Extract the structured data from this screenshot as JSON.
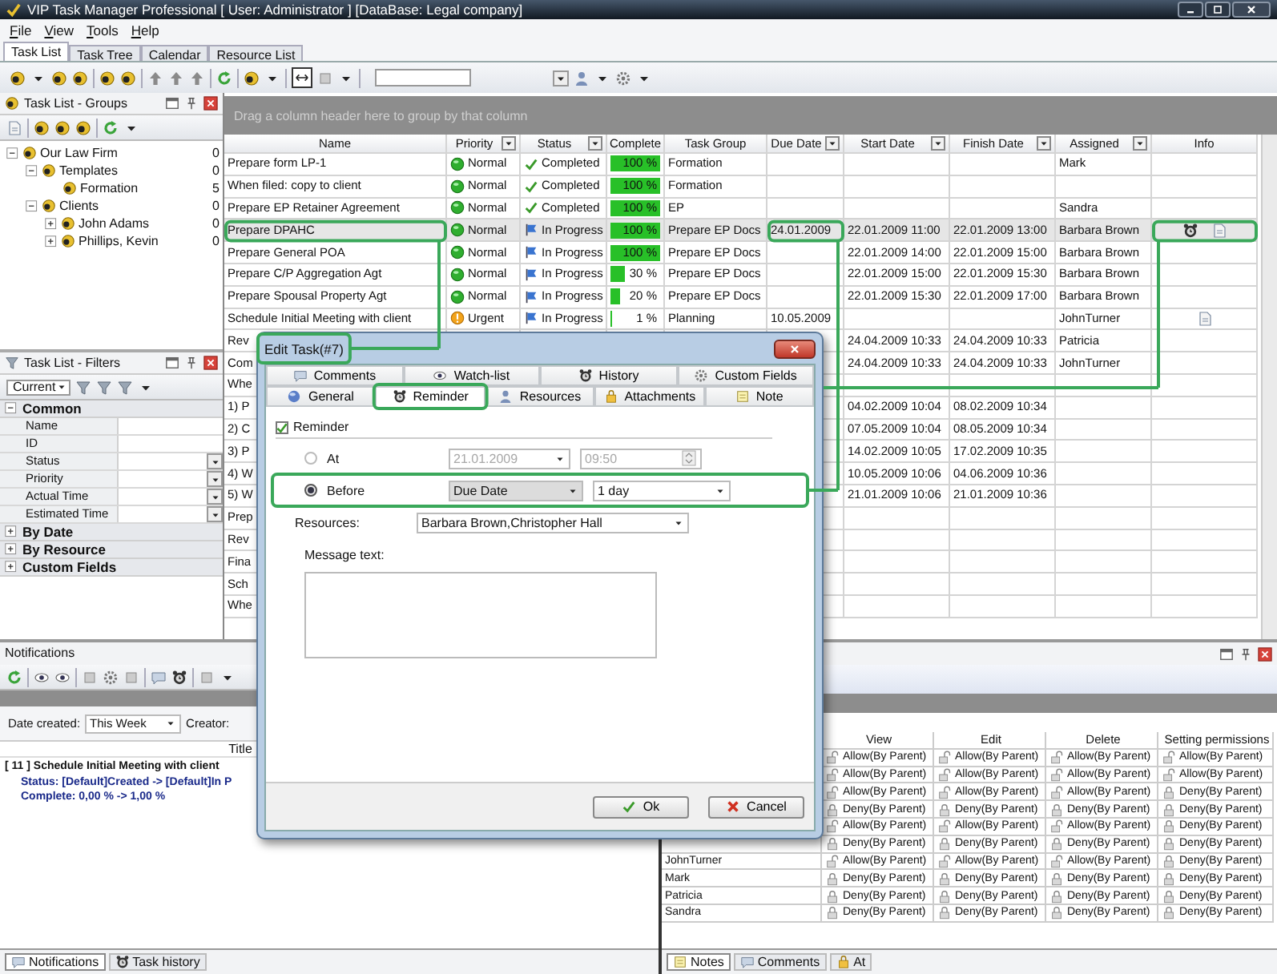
{
  "window": {
    "title": "VIP Task Manager Professional [ User: Administrator ] [DataBase: Legal company]"
  },
  "menu": [
    "File",
    "View",
    "Tools",
    "Help"
  ],
  "view_tabs": [
    {
      "label": "Task List",
      "selected": true
    },
    {
      "label": "Task Tree",
      "selected": false
    },
    {
      "label": "Calendar",
      "selected": false
    },
    {
      "label": "Resource List",
      "selected": false
    }
  ],
  "groups_panel": {
    "title": "Task List - Groups",
    "tree": [
      {
        "label": "Our Law Firm",
        "count": "0",
        "expanded": true,
        "children": [
          {
            "label": "Templates",
            "count": "0",
            "expanded": true,
            "children": [
              {
                "label": "Formation",
                "count": "5"
              }
            ]
          },
          {
            "label": "Clients",
            "count": "0",
            "expanded": true,
            "children": [
              {
                "label": "John Adams",
                "count": "0",
                "expanded": false
              },
              {
                "label": "Phillips, Kevin",
                "count": "0",
                "expanded": false
              }
            ]
          }
        ]
      }
    ]
  },
  "filters_panel": {
    "title": "Task List - Filters",
    "filter": "Current",
    "sections": [
      {
        "label": "Common",
        "expanded": true,
        "fields": [
          {
            "label": "Name",
            "dropdown": false
          },
          {
            "label": "ID",
            "dropdown": false
          },
          {
            "label": "Status",
            "dropdown": true
          },
          {
            "label": "Priority",
            "dropdown": true
          },
          {
            "label": "Actual Time",
            "dropdown": true
          },
          {
            "label": "Estimated Time",
            "dropdown": true
          }
        ]
      },
      {
        "label": "By Date",
        "expanded": false
      },
      {
        "label": "By Resource",
        "expanded": false
      },
      {
        "label": "Custom Fields",
        "expanded": false
      }
    ]
  },
  "task_grid": {
    "group_hint": "Drag a column header here to group by that column",
    "columns": [
      {
        "label": "Name",
        "filter": false
      },
      {
        "label": "Priority",
        "filter": true
      },
      {
        "label": "Status",
        "filter": true
      },
      {
        "label": "Complete",
        "filter": false
      },
      {
        "label": "Task Group",
        "filter": false
      },
      {
        "label": "Due Date",
        "filter": true
      },
      {
        "label": "Start Date",
        "filter": true
      },
      {
        "label": "Finish Date",
        "filter": true
      },
      {
        "label": "Assigned",
        "filter": true
      },
      {
        "label": "Info",
        "filter": false
      }
    ],
    "rows": [
      {
        "selected": false,
        "name": "Prepare form LP-1",
        "priority": {
          "kind": "normal",
          "text": "Normal"
        },
        "status": {
          "kind": "completed",
          "text": "Completed"
        },
        "complete": {
          "text": "100 %",
          "level": 1
        },
        "group": "Formation",
        "assigned": "Mark"
      },
      {
        "selected": false,
        "name": "When filed:  copy to client",
        "priority": {
          "kind": "normal",
          "text": "Normal"
        },
        "status": {
          "kind": "completed",
          "text": "Completed"
        },
        "complete": {
          "text": "100 %",
          "level": 1
        },
        "group": "Formation"
      },
      {
        "selected": false,
        "name": "Prepare EP Retainer Agreement",
        "priority": {
          "kind": "normal",
          "text": "Normal"
        },
        "status": {
          "kind": "completed",
          "text": "Completed"
        },
        "complete": {
          "text": "100 %",
          "level": 1
        },
        "group": "EP",
        "assigned": "Sandra"
      },
      {
        "selected": true,
        "name": "Prepare DPAHC",
        "priority": {
          "kind": "normal",
          "text": "Normal"
        },
        "status": {
          "kind": "progress",
          "text": "In Progress"
        },
        "complete": {
          "text": "100 %",
          "level": 1
        },
        "group": "Prepare EP Docs",
        "due": "24.01.2009",
        "start": "22.01.2009 11:00",
        "finish": "22.01.2009 13:00",
        "assigned": "Barbara Brown",
        "info": [
          {
            "kind": "reminder"
          },
          {
            "kind": "attachment"
          }
        ]
      },
      {
        "selected": false,
        "name": "Prepare General POA",
        "priority": {
          "kind": "normal",
          "text": "Normal"
        },
        "status": {
          "kind": "progress",
          "text": "In Progress"
        },
        "complete": {
          "text": "100 %",
          "level": 1
        },
        "group": "Prepare EP Docs",
        "start": "22.01.2009 14:00",
        "finish": "22.01.2009 15:00",
        "assigned": "Barbara Brown"
      },
      {
        "selected": false,
        "name": "Prepare C/P Aggregation Agt",
        "priority": {
          "kind": "normal",
          "text": "Normal"
        },
        "status": {
          "kind": "progress",
          "text": "In Progress"
        },
        "complete": {
          "text": "30 %",
          "level": 0.3
        },
        "group": "Prepare EP Docs",
        "start": "22.01.2009 15:00",
        "finish": "22.01.2009 15:30",
        "assigned": "Barbara Brown"
      },
      {
        "selected": false,
        "name": "Prepare Spousal Property Agt",
        "priority": {
          "kind": "normal",
          "text": "Normal"
        },
        "status": {
          "kind": "progress",
          "text": "In Progress"
        },
        "complete": {
          "text": "20 %",
          "level": 0.2
        },
        "group": "Prepare EP Docs",
        "start": "22.01.2009 15:30",
        "finish": "22.01.2009 17:00",
        "assigned": "Barbara Brown"
      },
      {
        "selected": false,
        "name": "Schedule Initial Meeting with client",
        "priority": {
          "kind": "urgent",
          "text": "Urgent"
        },
        "status": {
          "kind": "progress",
          "text": "In Progress"
        },
        "complete": {
          "text": "1 %",
          "level": 0.01
        },
        "group": "Planning",
        "due": "10.05.2009",
        "assigned": "JohnTurner",
        "info": [
          {
            "kind": "attachment"
          }
        ]
      },
      {
        "selected": false,
        "name": "Rev",
        "start": "24.04.2009 10:33",
        "finish": "24.04.2009 10:33",
        "assigned": "Patricia"
      },
      {
        "selected": false,
        "name": "Com",
        "start": "24.04.2009 10:33",
        "finish": "24.04.2009 10:33",
        "assigned": "JohnTurner"
      },
      {
        "selected": false,
        "name": "Whe"
      },
      {
        "selected": false,
        "name": "1) P",
        "start": "04.02.2009 10:04",
        "finish": "08.02.2009 10:34"
      },
      {
        "selected": false,
        "name": "2) C",
        "start": "07.05.2009 10:04",
        "finish": "08.05.2009 10:34"
      },
      {
        "selected": false,
        "name": "3) P",
        "start": "14.02.2009 10:05",
        "finish": "17.02.2009 10:35"
      },
      {
        "selected": false,
        "name": "4) W",
        "start": "10.05.2009 10:06",
        "finish": "04.06.2009 10:36"
      },
      {
        "selected": false,
        "name": "5) W",
        "start": "21.01.2009 10:06",
        "finish": "21.01.2009 10:36"
      },
      {
        "selected": false,
        "name": "Prep"
      },
      {
        "selected": false,
        "name": "Rev"
      },
      {
        "selected": false,
        "name": "Fina"
      },
      {
        "selected": false,
        "name": "Sch"
      },
      {
        "selected": false,
        "name": "Whe"
      }
    ]
  },
  "dialog": {
    "title": "Edit Task(#7)",
    "tab_rows": [
      [
        {
          "label": "Comments",
          "selected": false
        },
        {
          "label": "Watch-list",
          "selected": false
        },
        {
          "label": "History",
          "selected": false
        },
        {
          "label": "Custom Fields",
          "selected": false
        }
      ],
      [
        {
          "label": "General",
          "selected": false
        },
        {
          "label": "Reminder",
          "selected": true
        },
        {
          "label": "Resources",
          "selected": false
        },
        {
          "label": "Attachments",
          "selected": false
        },
        {
          "label": "Note",
          "selected": false
        }
      ]
    ],
    "reminder": {
      "label": "Reminder",
      "checked": true
    },
    "at": {
      "label": "At",
      "selected": false,
      "disabled": true,
      "date": "21.01.2009",
      "time": "09:50"
    },
    "before": {
      "label": "Before",
      "selected": true,
      "reference": "Due Date",
      "offset": "1 day"
    },
    "resources": {
      "label": "Resources:",
      "value": "Barbara Brown,Christopher Hall"
    },
    "message": {
      "label": "Message text:"
    },
    "buttons": [
      {
        "kind": "ok",
        "label": "Ok"
      },
      {
        "kind": "cancel",
        "label": "Cancel"
      }
    ]
  },
  "notifications": {
    "title": "Notifications",
    "date_label": "Date created:",
    "date_value": "This Week",
    "creator_label": "Creator:",
    "column": "Title",
    "items": [
      {
        "title": "[ 11 ] Schedule Initial Meeting with client",
        "details": [
          "Status: [Default]Created -> [Default]In P",
          "Complete: 0,00 % -> 1,00 %"
        ]
      }
    ],
    "tabs": [
      {
        "label": "Notifications",
        "selected": true
      },
      {
        "label": "Task history",
        "selected": false
      }
    ]
  },
  "permissions": {
    "columns": [
      "View",
      "Edit",
      "Delete",
      "Setting permissions"
    ],
    "rows": [
      {
        "cells": [
          {
            "kind": "allow",
            "text": "Allow(By Parent)"
          },
          {
            "kind": "allow",
            "text": "Allow(By Parent)"
          },
          {
            "kind": "allow",
            "text": "Allow(By Parent)"
          },
          {
            "kind": "allow",
            "text": "Allow(By Parent)"
          }
        ]
      },
      {
        "cells": [
          {
            "kind": "allow",
            "text": "Allow(By Parent)"
          },
          {
            "kind": "allow",
            "text": "Allow(By Parent)"
          },
          {
            "kind": "allow",
            "text": "Allow(By Parent)"
          },
          {
            "kind": "allow",
            "text": "Allow(By Parent)"
          }
        ]
      },
      {
        "cells": [
          {
            "kind": "allow",
            "text": "Allow(By Parent)"
          },
          {
            "kind": "allow",
            "text": "Allow(By Parent)"
          },
          {
            "kind": "allow",
            "text": "Allow(By Parent)"
          },
          {
            "kind": "deny",
            "text": "Deny(By Parent)"
          }
        ]
      },
      {
        "cells": [
          {
            "kind": "deny",
            "text": "Deny(By Parent)"
          },
          {
            "kind": "deny",
            "text": "Deny(By Parent)"
          },
          {
            "kind": "deny",
            "text": "Deny(By Parent)"
          },
          {
            "kind": "deny",
            "text": "Deny(By Parent)"
          }
        ]
      },
      {
        "cells": [
          {
            "kind": "allow",
            "text": "Allow(By Parent)"
          },
          {
            "kind": "allow",
            "text": "Allow(By Parent)"
          },
          {
            "kind": "allow",
            "text": "Allow(By Parent)"
          },
          {
            "kind": "deny",
            "text": "Deny(By Parent)"
          }
        ]
      },
      {
        "cells": [
          {
            "kind": "deny",
            "text": "Deny(By Parent)"
          },
          {
            "kind": "deny",
            "text": "Deny(By Parent)"
          },
          {
            "kind": "deny",
            "text": "Deny(By Parent)"
          },
          {
            "kind": "deny",
            "text": "Deny(By Parent)"
          }
        ]
      },
      {
        "name": "JohnTurner",
        "cells": [
          {
            "kind": "allow",
            "text": "Allow(By Parent)"
          },
          {
            "kind": "allow",
            "text": "Allow(By Parent)"
          },
          {
            "kind": "allow",
            "text": "Allow(By Parent)"
          },
          {
            "kind": "deny",
            "text": "Deny(By Parent)"
          }
        ]
      },
      {
        "name": "Mark",
        "cells": [
          {
            "kind": "deny",
            "text": "Deny(By Parent)"
          },
          {
            "kind": "deny",
            "text": "Deny(By Parent)"
          },
          {
            "kind": "deny",
            "text": "Deny(By Parent)"
          },
          {
            "kind": "deny",
            "text": "Deny(By Parent)"
          }
        ]
      },
      {
        "name": "Patricia",
        "cells": [
          {
            "kind": "deny",
            "text": "Deny(By Parent)"
          },
          {
            "kind": "deny",
            "text": "Deny(By Parent)"
          },
          {
            "kind": "deny",
            "text": "Deny(By Parent)"
          },
          {
            "kind": "deny",
            "text": "Deny(By Parent)"
          }
        ]
      },
      {
        "name": "Sandra",
        "cells": [
          {
            "kind": "deny",
            "text": "Deny(By Parent)"
          },
          {
            "kind": "deny",
            "text": "Deny(By Parent)"
          },
          {
            "kind": "deny",
            "text": "Deny(By Parent)"
          },
          {
            "kind": "deny",
            "text": "Deny(By Parent)"
          }
        ]
      }
    ],
    "tabs": [
      {
        "label": "Notes",
        "selected": true
      },
      {
        "label": "Comments",
        "selected": false
      },
      {
        "label": "At",
        "selected": false
      }
    ]
  }
}
